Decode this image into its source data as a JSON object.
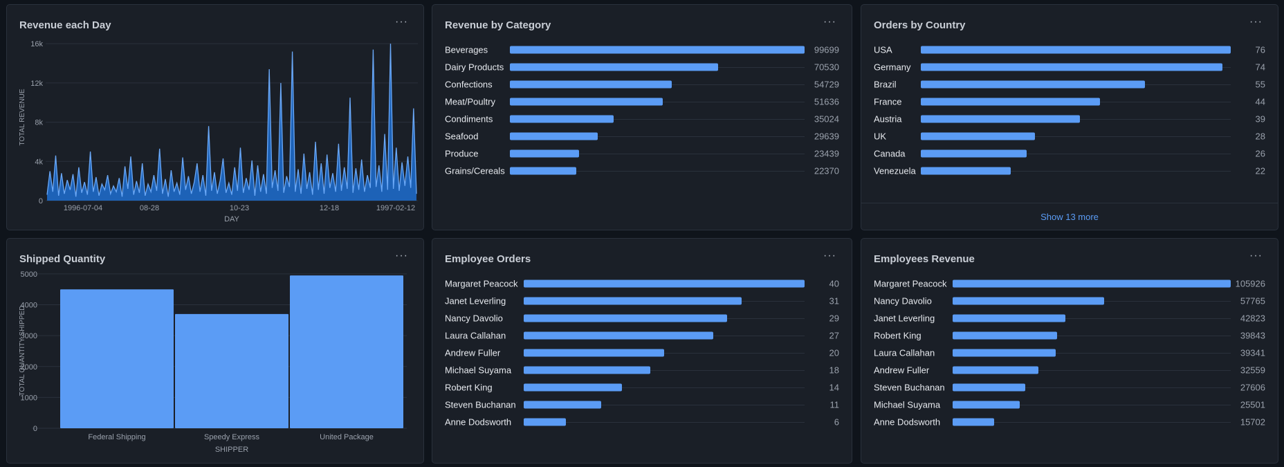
{
  "colors": {
    "accent": "#5b9cf5",
    "card": "#1a1f27",
    "background": "#0f141b"
  },
  "revenue_day": {
    "title": "Revenue each Day",
    "chart_data": {
      "type": "area",
      "title": "Revenue each Day",
      "xlabel": "DAY",
      "ylabel": "TOTAL REVENUE",
      "ylim": [
        0,
        17000
      ],
      "ytick_labels": [
        "0",
        "4k",
        "8k",
        "12k",
        "16k"
      ],
      "ytick_values": [
        0,
        4000,
        8000,
        12000,
        16000
      ],
      "xtick_labels": [
        "1996-07-04",
        "08-28",
        "10-23",
        "12-18",
        "1997-02-12"
      ],
      "values": [
        600,
        3000,
        900,
        4600,
        500,
        2800,
        700,
        2100,
        1100,
        2700,
        400,
        3400,
        800,
        1900,
        600,
        5000,
        900,
        2400,
        500,
        1700,
        1100,
        2600,
        700,
        1500,
        900,
        2300,
        400,
        3500,
        1200,
        4500,
        600,
        2000,
        800,
        3800,
        500,
        1700,
        900,
        2600,
        1000,
        5300,
        700,
        2200,
        400,
        3100,
        900,
        1800,
        600,
        4400,
        1100,
        2500,
        700,
        1900,
        3800,
        900,
        2600,
        500,
        7600,
        1000,
        2900,
        700,
        2100,
        4300,
        800,
        1800,
        600,
        3400,
        1000,
        5400,
        800,
        2300,
        1100,
        4100,
        500,
        3600,
        900,
        2700,
        700,
        13400,
        1300,
        3100,
        1000,
        12000,
        800,
        2500,
        1400,
        15200,
        900,
        3200,
        700,
        4800,
        1200,
        2900,
        600,
        6000,
        1100,
        3800,
        700,
        4700,
        1300,
        2800,
        900,
        5800,
        1000,
        3400,
        1200,
        10500,
        800,
        3300,
        1100,
        4200,
        900,
        2600,
        1300,
        15400,
        1400,
        3600,
        900,
        6800,
        1100,
        16000,
        1200,
        5400,
        1000,
        3900,
        1500,
        4500,
        1300,
        9400,
        700
      ]
    }
  },
  "revenue_category": {
    "title": "Revenue by Category",
    "max": 99699,
    "items": [
      {
        "label": "Beverages",
        "value": 99699,
        "value_text": "99699"
      },
      {
        "label": "Dairy Products",
        "value": 70530,
        "value_text": "70530"
      },
      {
        "label": "Confections",
        "value": 54729,
        "value_text": "54729"
      },
      {
        "label": "Meat/Poultry",
        "value": 51636,
        "value_text": "51636"
      },
      {
        "label": "Condiments",
        "value": 35024,
        "value_text": "35024"
      },
      {
        "label": "Seafood",
        "value": 29639,
        "value_text": "29639"
      },
      {
        "label": "Produce",
        "value": 23439,
        "value_text": "23439"
      },
      {
        "label": "Grains/Cereals",
        "value": 22370,
        "value_text": "22370"
      }
    ]
  },
  "orders_country": {
    "title": "Orders by Country",
    "max": 76,
    "show_more": "Show 13 more",
    "items": [
      {
        "label": "USA",
        "value": 76,
        "value_text": "76"
      },
      {
        "label": "Germany",
        "value": 74,
        "value_text": "74"
      },
      {
        "label": "Brazil",
        "value": 55,
        "value_text": "55"
      },
      {
        "label": "France",
        "value": 44,
        "value_text": "44"
      },
      {
        "label": "Austria",
        "value": 39,
        "value_text": "39"
      },
      {
        "label": "UK",
        "value": 28,
        "value_text": "28"
      },
      {
        "label": "Canada",
        "value": 26,
        "value_text": "26"
      },
      {
        "label": "Venezuela",
        "value": 22,
        "value_text": "22"
      }
    ]
  },
  "shipped_quantity": {
    "title": "Shipped Quantity",
    "chart_data": {
      "type": "bar",
      "title": "Shipped Quantity",
      "xlabel": "SHIPPER",
      "ylabel": "TOTAL QUANTITY SHIPPED",
      "ylim": [
        0,
        5000
      ],
      "ytick_labels": [
        "0",
        "1000",
        "2000",
        "3000",
        "4000",
        "5000"
      ],
      "ytick_values": [
        0,
        1000,
        2000,
        3000,
        4000,
        5000
      ],
      "categories": [
        "Federal Shipping",
        "Speedy Express",
        "United Package"
      ],
      "values": [
        4500,
        3700,
        4950
      ]
    }
  },
  "employee_orders": {
    "title": "Employee Orders",
    "max": 40,
    "items": [
      {
        "label": "Margaret Peacock",
        "value": 40,
        "value_text": "40"
      },
      {
        "label": "Janet Leverling",
        "value": 31,
        "value_text": "31"
      },
      {
        "label": "Nancy Davolio",
        "value": 29,
        "value_text": "29"
      },
      {
        "label": "Laura Callahan",
        "value": 27,
        "value_text": "27"
      },
      {
        "label": "Andrew Fuller",
        "value": 20,
        "value_text": "20"
      },
      {
        "label": "Michael Suyama",
        "value": 18,
        "value_text": "18"
      },
      {
        "label": "Robert King",
        "value": 14,
        "value_text": "14"
      },
      {
        "label": "Steven Buchanan",
        "value": 11,
        "value_text": "11"
      },
      {
        "label": "Anne Dodsworth",
        "value": 6,
        "value_text": "6"
      }
    ]
  },
  "employees_revenue": {
    "title": "Employees Revenue",
    "max": 105926,
    "items": [
      {
        "label": "Margaret Peacock",
        "value": 105926,
        "value_text": "105926"
      },
      {
        "label": "Nancy Davolio",
        "value": 57765,
        "value_text": "57765"
      },
      {
        "label": "Janet Leverling",
        "value": 42823,
        "value_text": "42823"
      },
      {
        "label": "Robert King",
        "value": 39843,
        "value_text": "39843"
      },
      {
        "label": "Laura Callahan",
        "value": 39341,
        "value_text": "39341"
      },
      {
        "label": "Andrew Fuller",
        "value": 32559,
        "value_text": "32559"
      },
      {
        "label": "Steven Buchanan",
        "value": 27606,
        "value_text": "27606"
      },
      {
        "label": "Michael Suyama",
        "value": 25501,
        "value_text": "25501"
      },
      {
        "label": "Anne Dodsworth",
        "value": 15702,
        "value_text": "15702"
      }
    ]
  }
}
